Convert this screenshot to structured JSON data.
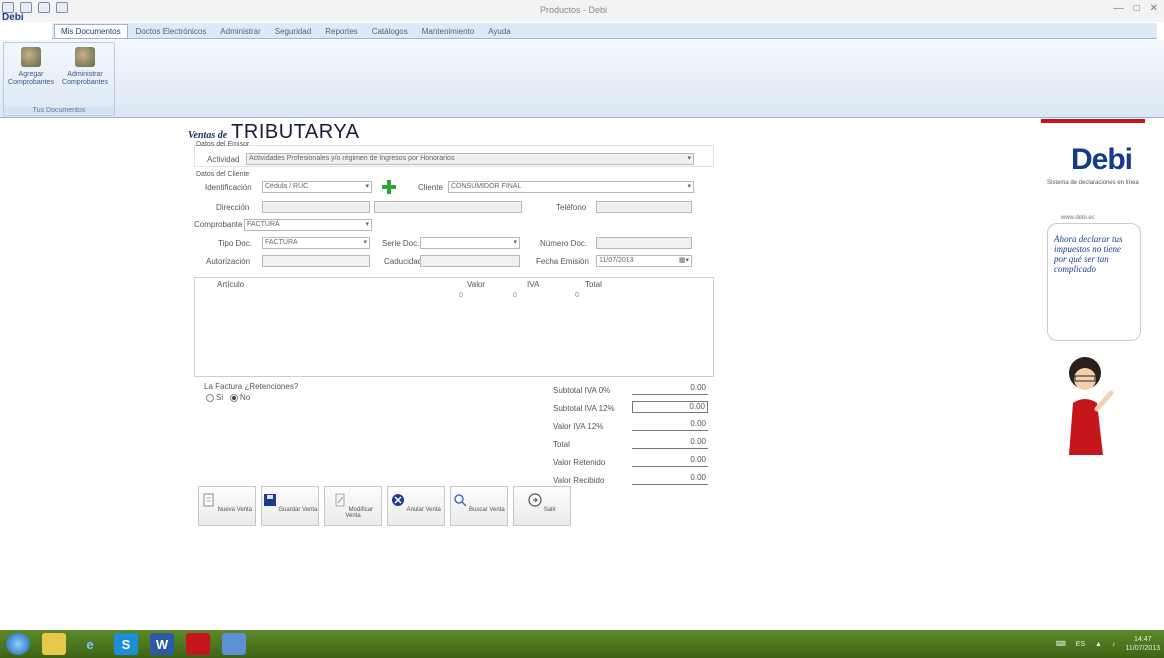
{
  "window": {
    "title": "Productos - Debi",
    "brand": "Debi"
  },
  "ribbon": {
    "tabs": [
      "Mis Documentos",
      "Doctos Electrónicos",
      "Administrar",
      "Seguridad",
      "Reportes",
      "Catálogos",
      "Mantenimiento",
      "Ayuda"
    ],
    "group_label": "Tus Documentos",
    "buttons": [
      {
        "label": "Agregar Comprobantes"
      },
      {
        "label": "Administrar Comprobantes"
      }
    ]
  },
  "form": {
    "title_prefix": "Ventas de",
    "title": "TRIBUTARYA",
    "section_activity": "Datos del Emisor",
    "activity_label": "Actividad",
    "activity_value": "Actividades Profesionales y/o régimen de Ingresos por Honorarios",
    "section_client": "Datos del Cliente",
    "client_id_label": "Identificación",
    "client_id_value": "Cédula / RUC",
    "client_label": "Cliente",
    "client_value": "CONSUMIDOR FINAL",
    "address_label": "Dirección",
    "phone_label": "Teléfono",
    "voucher_label": "Comprobante",
    "voucher_value": "FACTURA",
    "doc_type_label": "Tipo Doc.",
    "doc_type_value": "FACTURA",
    "series_label": "Serie Doc.",
    "number_label": "Número Doc.",
    "auth_label": "Autorización",
    "expiry_label": "Caducidad",
    "issue_date_label": "Fecha Emisión",
    "issue_date_value": "11/07/2013",
    "grid_headers": [
      "Artículo",
      "Valor",
      "IVA",
      "Total"
    ],
    "grid_row": [
      "",
      "0",
      "0",
      "0"
    ],
    "factura_q": "La Factura ¿Retenciones?",
    "radio_yes": "Si",
    "radio_no": "No"
  },
  "totals": [
    {
      "label": "Subtotal IVA 0%",
      "value": "0.00"
    },
    {
      "label": "Subtotal IVA 12%",
      "value": "0.00"
    },
    {
      "label": "Valor IVA 12%",
      "value": "0.00"
    },
    {
      "label": "Total",
      "value": "0.00"
    },
    {
      "label": "Valor Retenido",
      "value": "0.00"
    },
    {
      "label": "Valor Recibido",
      "value": "0.00"
    }
  ],
  "actions": [
    "Nueva Venta",
    "Guardar Venta",
    "Modificar Venta",
    "Anular Venta",
    "Buscar Venta",
    "Salir"
  ],
  "ad": {
    "logo": "Debi",
    "tagline": "Sistema de declaraciones en línea",
    "site": "www.debi.ec",
    "bubble": "Ahora declarar tus impuestos no tiene por qué ser tan complicado"
  },
  "tray": {
    "time": "14:47",
    "date": "11/07/2013",
    "lang": "ES"
  },
  "colors": {
    "ribbon": "#dfe9f6",
    "taskbar": "#4f7a22",
    "ad_accent": "#c6161d",
    "brand": "#143a8c"
  }
}
